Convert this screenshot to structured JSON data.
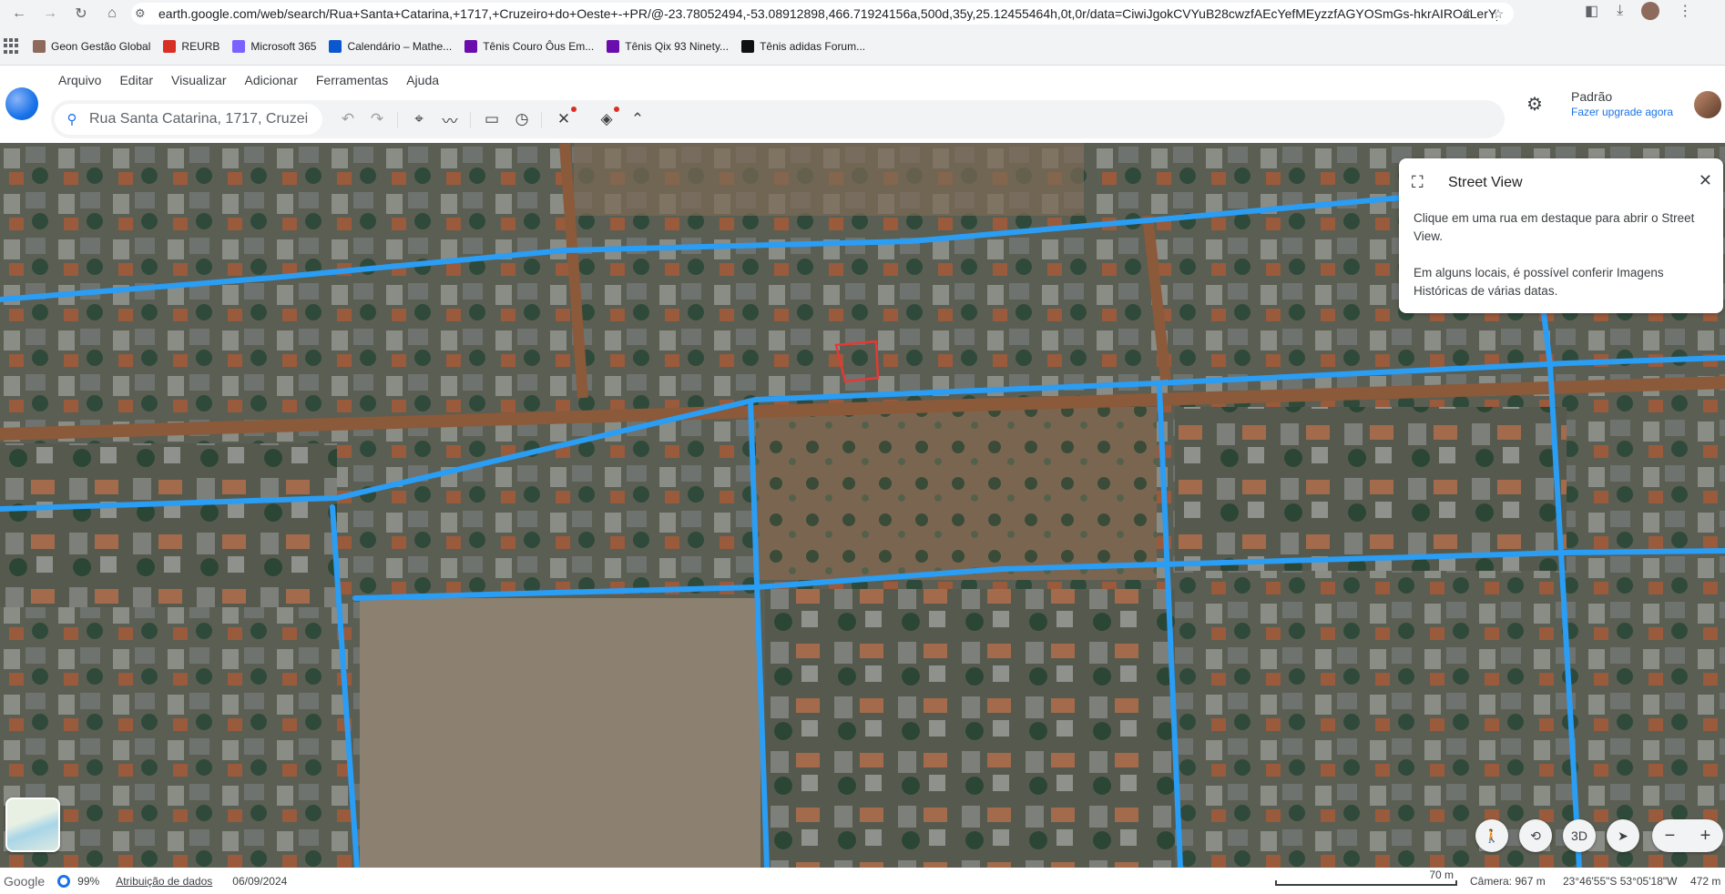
{
  "browser": {
    "url": "earth.google.com/web/search/Rua+Santa+Catarina,+1717,+Cruzeiro+do+Oeste+-+PR/@-23.78052494,-53.08912898,466.71924156a,500d,35y,25.12455464h,0t,0r/data=CiwiJgokCVYuB28cwzfAEcYefMEyzzfAGYOSmGs-hkrAIROaLerYj0rAQ..."
  },
  "bookmarks": [
    {
      "label": "Geon Gestão Global",
      "color": "#8e6a5c"
    },
    {
      "label": "REURB",
      "color": "#d93025"
    },
    {
      "label": "Microsoft 365",
      "color": "#7b61ff"
    },
    {
      "label": "Calendário – Mathe...",
      "color": "#0b57d0"
    },
    {
      "label": "Tênis Couro Ôus Em...",
      "color": "#6a0dad"
    },
    {
      "label": "Tênis Qix 93 Ninety...",
      "color": "#6a0dad"
    },
    {
      "label": "Tênis adidas Forum...",
      "color": "#111111"
    }
  ],
  "menu": [
    "Arquivo",
    "Editar",
    "Visualizar",
    "Adicionar",
    "Ferramentas",
    "Ajuda"
  ],
  "search": {
    "value": "Rua Santa Catarina, 1717, Cruzeiro"
  },
  "account": {
    "plan": "Padrão",
    "upgrade": "Fazer upgrade agora"
  },
  "street_view": {
    "title": "Street View",
    "text1": "Clique em uma rua em destaque para abrir o Street View.",
    "text2": "Em alguns locais, é possível conferir Imagens Históricas de várias datas."
  },
  "controls": {
    "three_d": "3D",
    "zoom_out": "−",
    "zoom_in": "+"
  },
  "status": {
    "brand": "Google",
    "percent": "99%",
    "attribution": "Atribuição de dados",
    "date": "06/09/2024",
    "scale": "70 m",
    "camera": "Câmera: 967 m",
    "coords": "23°46'55\"S 53°05'18\"W",
    "altitude": "472 m"
  },
  "colors": {
    "street_highlight": "#2a9df4",
    "accent": "#1a73e8",
    "selection": "#e53935"
  }
}
